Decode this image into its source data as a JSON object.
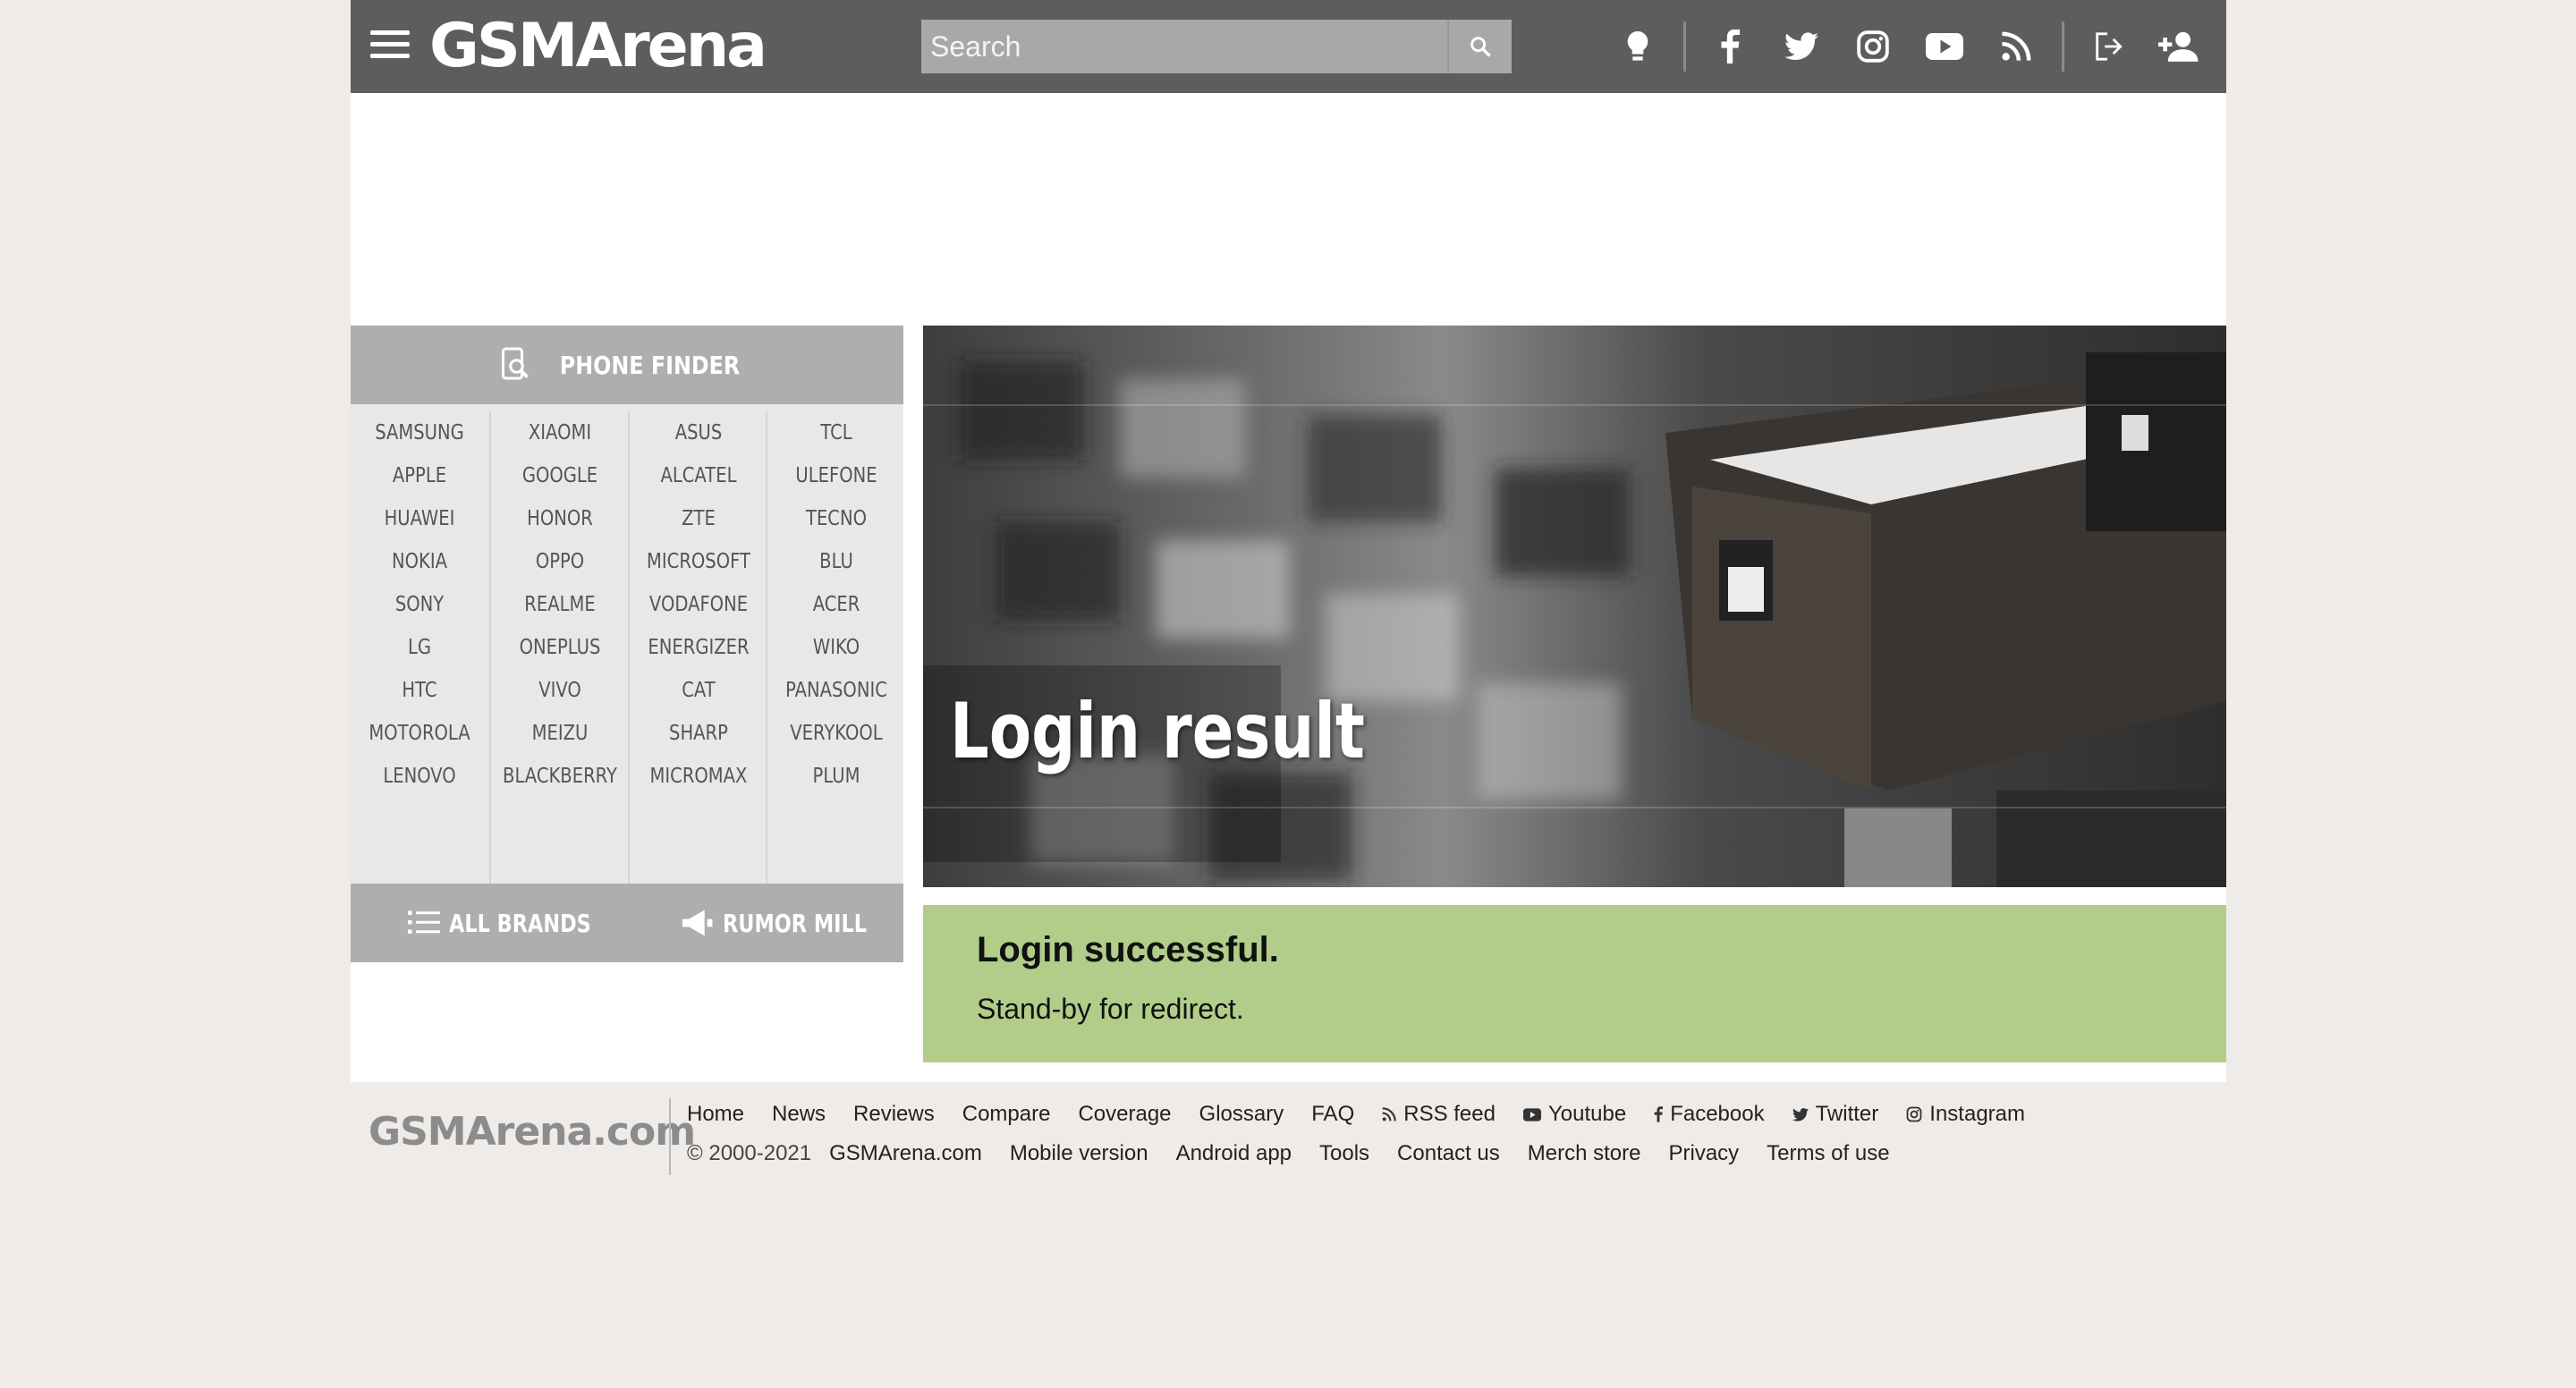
{
  "header": {
    "logo": "GSMArena",
    "search_placeholder": "Search",
    "icons": [
      "menu-icon",
      "search-icon",
      "lightbulb-icon",
      "facebook-icon",
      "twitter-icon",
      "instagram-icon",
      "youtube-icon",
      "rss-icon",
      "login-icon",
      "signup-icon"
    ]
  },
  "sidebar": {
    "finder_title": "PHONE FINDER",
    "brands": [
      [
        "SAMSUNG",
        "APPLE",
        "HUAWEI",
        "NOKIA",
        "SONY",
        "LG",
        "HTC",
        "MOTOROLA",
        "LENOVO"
      ],
      [
        "XIAOMI",
        "GOOGLE",
        "HONOR",
        "OPPO",
        "REALME",
        "ONEPLUS",
        "VIVO",
        "MEIZU",
        "BLACKBERRY"
      ],
      [
        "ASUS",
        "ALCATEL",
        "ZTE",
        "MICROSOFT",
        "VODAFONE",
        "ENERGIZER",
        "CAT",
        "SHARP",
        "MICROMAX"
      ],
      [
        "TCL",
        "ULEFONE",
        "TECNO",
        "BLU",
        "ACER",
        "WIKO",
        "PANASONIC",
        "VERYKOOL",
        "PLUM"
      ]
    ],
    "all_brands": "ALL BRANDS",
    "rumor_mill": "RUMOR MILL"
  },
  "hero": {
    "title": "Login result"
  },
  "result": {
    "heading": "Login successful.",
    "message": "Stand-by for redirect."
  },
  "footer": {
    "logo": "GSMArena.com",
    "row1": [
      "Home",
      "News",
      "Reviews",
      "Compare",
      "Coverage",
      "Glossary",
      "FAQ",
      "RSS feed",
      "Youtube",
      "Facebook",
      "Twitter",
      "Instagram"
    ],
    "copyright": "© 2000-2021",
    "row2": [
      "GSMArena.com",
      "Mobile version",
      "Android app",
      "Tools",
      "Contact us",
      "Merch store",
      "Privacy",
      "Terms of use"
    ]
  },
  "colors": {
    "header_bg": "#5d5d5d",
    "sidebar_head": "#aeaeae",
    "success_bg": "#b2cd8a",
    "page_bg": "#efebe8"
  }
}
